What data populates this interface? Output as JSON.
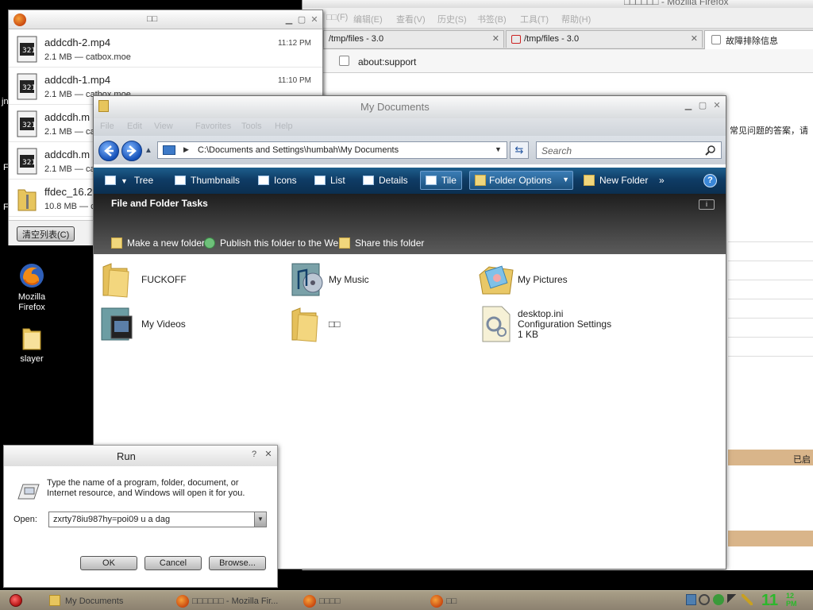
{
  "desktop": {
    "icons": [
      {
        "label": "Mozilla Firefox"
      },
      {
        "label": "slayer"
      }
    ],
    "partial_labels": [
      "jn",
      "F",
      "F"
    ]
  },
  "firefox": {
    "title": "□□□□□□ - Mozilla Firefox",
    "menus": [
      "□□(F)",
      "编辑(E)",
      "查看(V)",
      "历史(S)",
      "书签(B)",
      "工具(T)",
      "帮助(H)"
    ],
    "tabs": [
      {
        "label": "/tmp/files - 3.0"
      },
      {
        "label": "/tmp/files - 3.0"
      },
      {
        "label": "故障排除信息"
      }
    ],
    "url": "about:support",
    "content_snippet": "常见问题的答案，请",
    "content_right": "已启"
  },
  "downloads": {
    "title": "□□",
    "items": [
      {
        "name": "addcdh-2.mp4",
        "meta": "2.1 MB — catbox.moe",
        "time": "11:12 PM"
      },
      {
        "name": "addcdh-1.mp4",
        "meta": "2.1 MB — catbox.moe",
        "time": "11:10 PM"
      },
      {
        "name": "addcdh.m",
        "meta": "2.1 MB — ca",
        "time": ""
      },
      {
        "name": "addcdh.m",
        "meta": "2.1 MB — ca",
        "time": ""
      },
      {
        "name": "ffdec_16.2",
        "meta": "10.8 MB — c",
        "time": ""
      }
    ],
    "clear_label": "清空列表(C)"
  },
  "explorer": {
    "title": "My Documents",
    "menus": [
      "File",
      "Edit",
      "View",
      "Favorites",
      "Tools",
      "Help"
    ],
    "address": "C:\\Documents and Settings\\humbah\\My Documents",
    "search_placeholder": "Search",
    "toolbar": {
      "tree": "Tree",
      "thumbnails": "Thumbnails",
      "icons": "Icons",
      "list": "List",
      "details": "Details",
      "tile": "Tile",
      "folder_options": "Folder Options",
      "new_folder": "New Folder",
      "more": "»"
    },
    "tasks": {
      "title": "File and Folder Tasks",
      "links": [
        "Make a new folder",
        "Publish this folder to the Web",
        "Share this folder"
      ]
    },
    "files": [
      {
        "name": "FUCKOFF",
        "sub1": "",
        "sub2": ""
      },
      {
        "name": "My Music",
        "sub1": "",
        "sub2": ""
      },
      {
        "name": "My Pictures",
        "sub1": "",
        "sub2": ""
      },
      {
        "name": "My Videos",
        "sub1": "",
        "sub2": ""
      },
      {
        "name": "□□",
        "sub1": "",
        "sub2": ""
      },
      {
        "name": "desktop.ini",
        "sub1": "Configuration Settings",
        "sub2": "1 KB"
      }
    ]
  },
  "run": {
    "title": "Run",
    "description": "Type the name of a program, folder, document, or Internet resource, and Windows will open it for you.",
    "open_label": "Open:",
    "input_value": "zxrty78iu987hy=poi09 u  a dag",
    "ok": "OK",
    "cancel": "Cancel",
    "browse": "Browse..."
  },
  "taskbar": {
    "items": [
      {
        "label": "My Documents"
      },
      {
        "label": "□□□□□□ - Mozilla Fir..."
      },
      {
        "label": "□□□□"
      },
      {
        "label": "□□"
      }
    ],
    "clock": "11",
    "clock_small": "12 PM"
  },
  "colors": {
    "explorer_toolbar": "#0f3c66",
    "tasks_bg": "#1e1e1e",
    "taskbar": "#a99f88",
    "clock": "#2bb82b"
  }
}
